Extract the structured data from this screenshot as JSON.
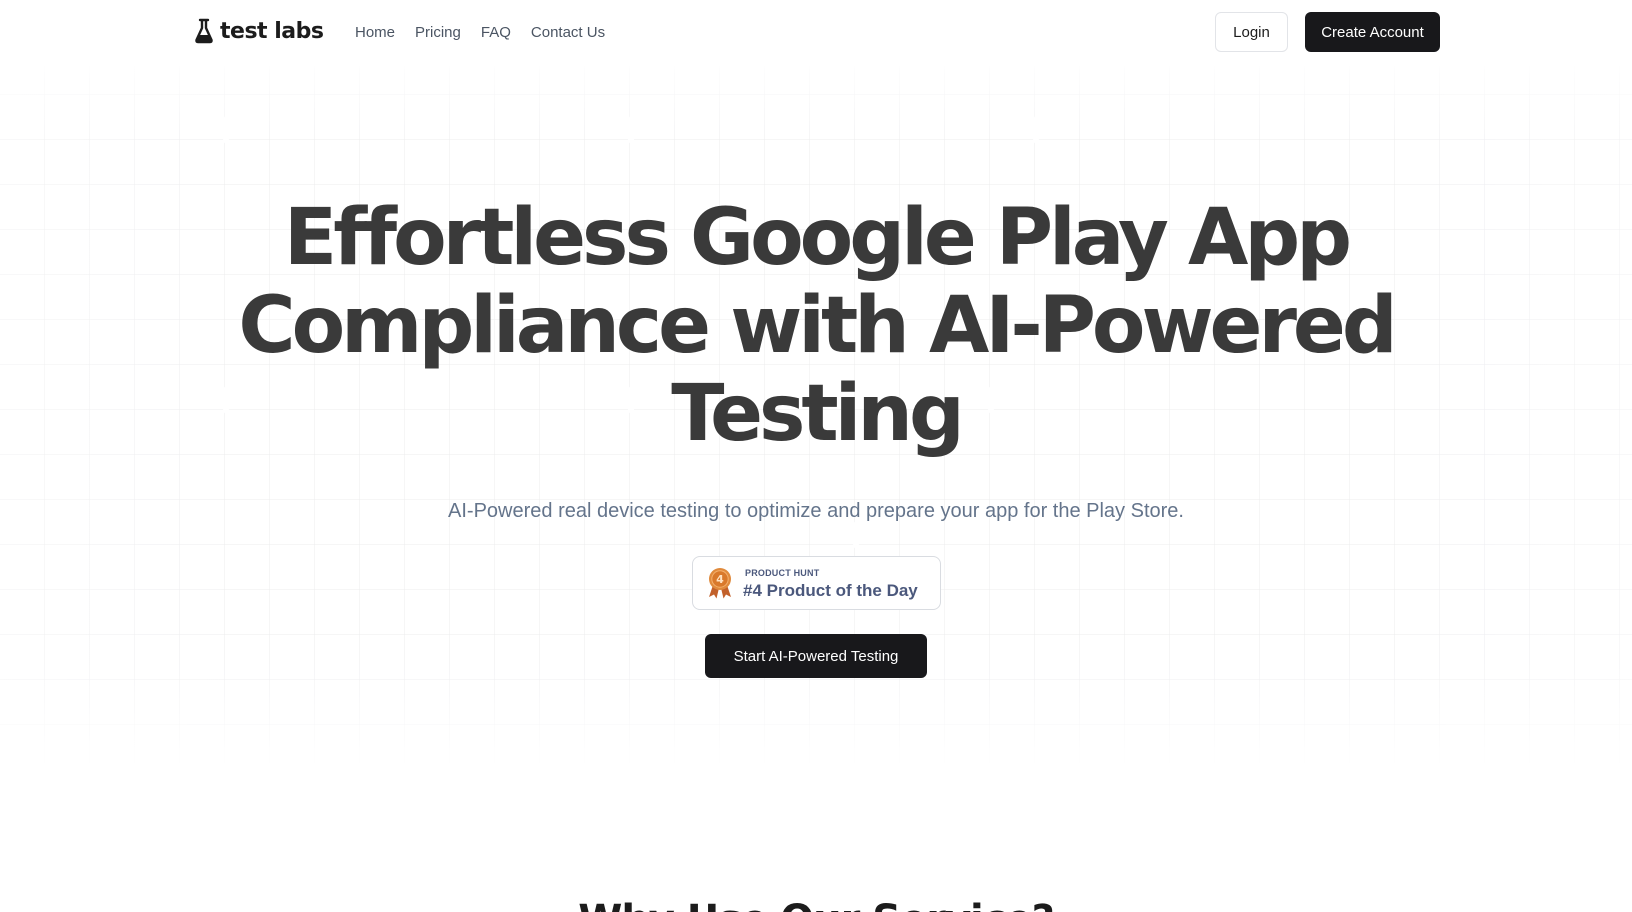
{
  "brand": {
    "name": "test labs",
    "icon": "flask-icon"
  },
  "nav": {
    "items": [
      {
        "label": "Home"
      },
      {
        "label": "Pricing"
      },
      {
        "label": "FAQ"
      },
      {
        "label": "Contact Us"
      }
    ]
  },
  "auth": {
    "login_label": "Login",
    "create_label": "Create Account"
  },
  "hero": {
    "title_lines": [
      "Effortless Google Play App",
      "Compliance with AI-Powered",
      "Testing"
    ],
    "subtitle": "AI-Powered real device testing to optimize and prepare your app for the Play Store.",
    "badge": {
      "kicker": "PRODUCT HUNT",
      "label": "#4 Product of the Day",
      "rank": "4",
      "icon": "award-medal-icon"
    },
    "cta_label": "Start AI-Powered Testing"
  },
  "next_section": {
    "heading": "Why Use Our Service?"
  },
  "colors": {
    "primary": "#18181b",
    "title": "#3a3a3a",
    "subtitle": "#64748b",
    "badge_text": "#4b587c",
    "medal": "#d9792b"
  }
}
